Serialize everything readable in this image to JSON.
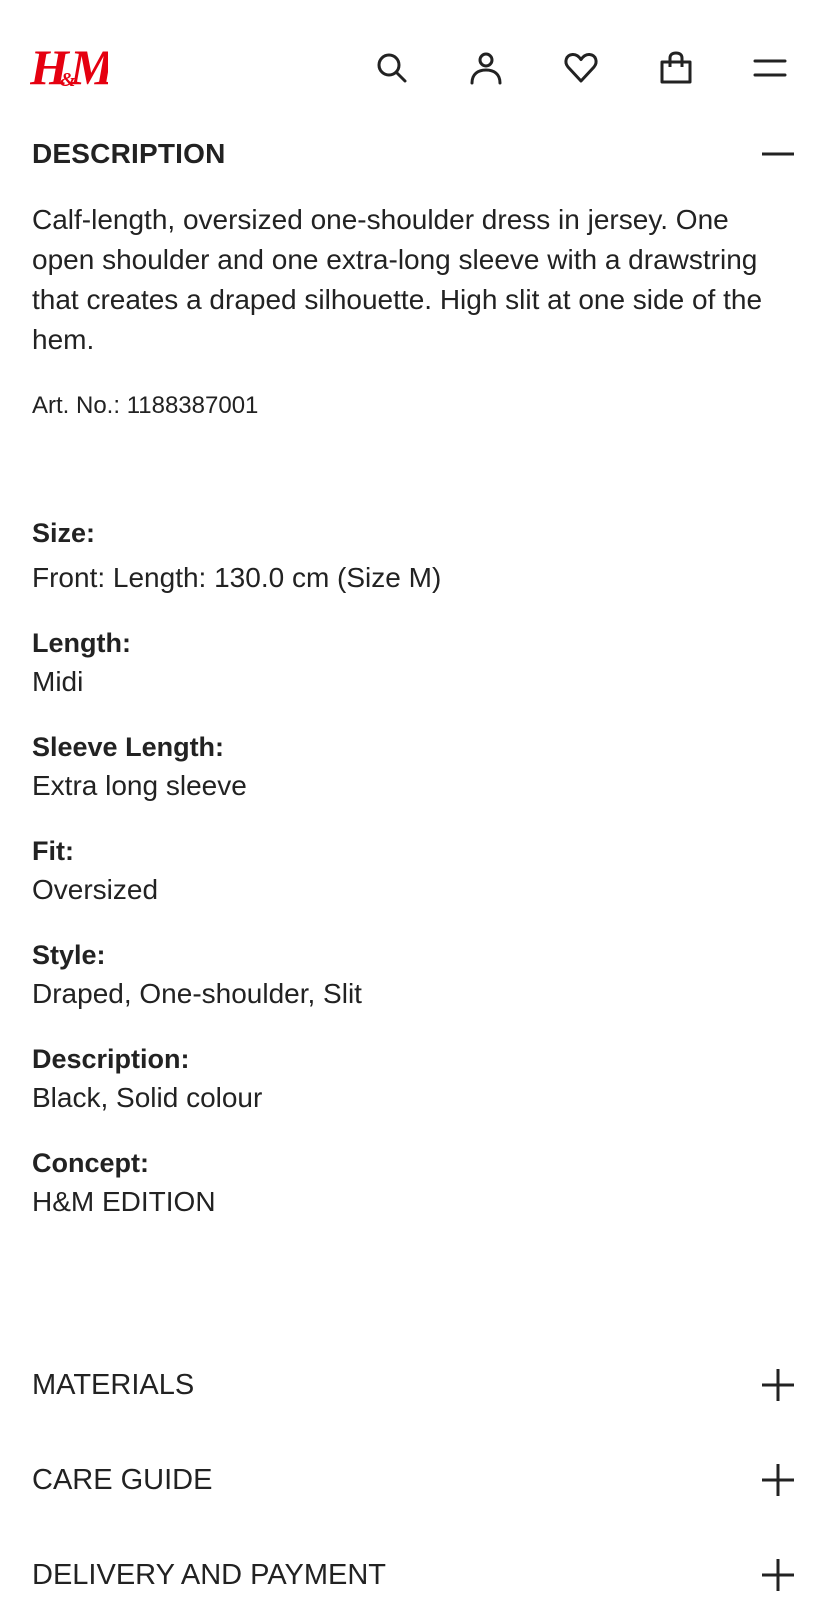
{
  "header": {
    "logo_text": "H&M",
    "brand_color": "#e50010",
    "icons": [
      "search-icon",
      "account-icon",
      "heart-icon",
      "bag-icon",
      "menu-icon"
    ]
  },
  "description": {
    "title": "DESCRIPTION",
    "text": "Calf-length, oversized one-shoulder dress in jersey. One open shoulder and one extra-long sleeve with a drawstring that creates a draped silhouette. High slit at one side of the hem.",
    "art_no": "Art. No.: 1188387001",
    "attributes": [
      {
        "label": "Size:",
        "value": "Front: Length: 130.0 cm (Size M)"
      },
      {
        "label": "Length:",
        "value": "Midi"
      },
      {
        "label": "Sleeve Length:",
        "value": "Extra long sleeve"
      },
      {
        "label": "Fit:",
        "value": "Oversized"
      },
      {
        "label": "Style:",
        "value": "Draped, One-shoulder, Slit"
      },
      {
        "label": "Description:",
        "value": "Black, Solid colour"
      },
      {
        "label": "Concept:",
        "value": "H&M EDITION"
      }
    ]
  },
  "accordion": [
    {
      "label": "MATERIALS"
    },
    {
      "label": "CARE GUIDE"
    },
    {
      "label": "DELIVERY AND PAYMENT"
    }
  ]
}
